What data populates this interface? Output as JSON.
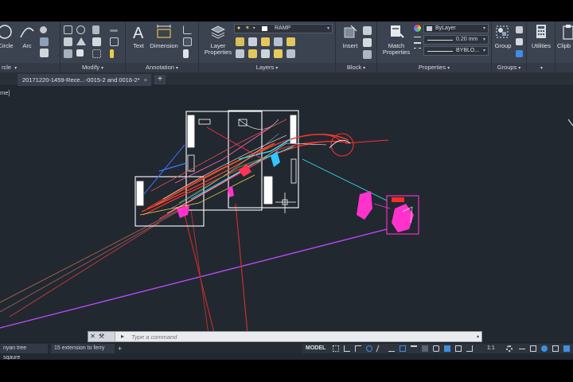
{
  "ribbon": {
    "draw": {
      "tools": [
        "Circle",
        "Arc"
      ]
    },
    "modify": {
      "title": "Modify"
    },
    "annotation": {
      "title": "Annotation",
      "tools": [
        "Text",
        "Dimension"
      ]
    },
    "layers": {
      "title": "Layers",
      "layer_properties_label": "Layer\nProperties",
      "current_layer": "RAMP"
    },
    "block": {
      "title": "Block",
      "insert_label": "Insert"
    },
    "properties": {
      "title": "Properties",
      "match_label": "Match\nProperties",
      "color": "ByLayer",
      "lineweight": "0.20 mm",
      "linetype": "BYBLO..."
    },
    "groups": {
      "title": "Groups",
      "group_label": "Group"
    },
    "utilities": {
      "label": "Utilities"
    },
    "clipboard": {
      "label": "Clipb"
    }
  },
  "file_tab": {
    "name": "20171220-1459-Rece...-0015-2 and 0016-2*"
  },
  "viewport": {
    "label": "me]"
  },
  "command_line": {
    "placeholder": "Type a command"
  },
  "layout_tabs": [
    "nyan tree sqaure",
    "15 extension to ferry"
  ],
  "status": {
    "model": "MODEL",
    "scale": "1:1"
  },
  "colors": {
    "ribbon": "#3b4250",
    "canvas": "#212830",
    "magenta": "#ff33cc",
    "red": "#ff2b2b",
    "cyan": "#33e5ff"
  }
}
